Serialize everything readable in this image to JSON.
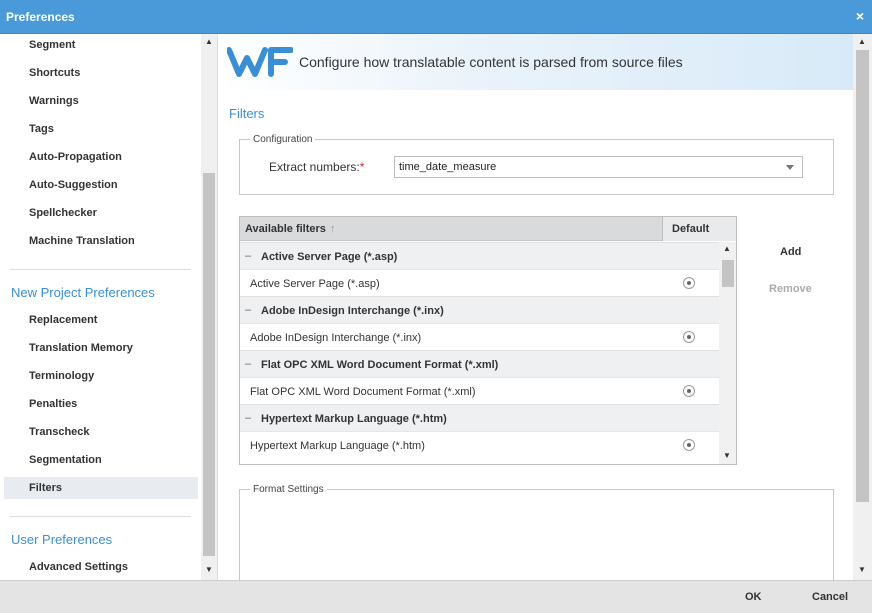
{
  "window": {
    "title": "Preferences",
    "close_icon": "×"
  },
  "sidebar": {
    "items_top": [
      {
        "label": "Segment"
      },
      {
        "label": "Shortcuts"
      },
      {
        "label": "Warnings"
      },
      {
        "label": "Tags"
      },
      {
        "label": "Auto-Propagation"
      },
      {
        "label": "Auto-Suggestion"
      },
      {
        "label": "Spellchecker"
      },
      {
        "label": "Machine Translation"
      }
    ],
    "new_project_heading": "New Project Preferences",
    "items_project": [
      {
        "label": "Replacement"
      },
      {
        "label": "Translation Memory"
      },
      {
        "label": "Terminology"
      },
      {
        "label": "Penalties"
      },
      {
        "label": "Transcheck"
      },
      {
        "label": "Segmentation"
      },
      {
        "label": "Filters",
        "active": true
      }
    ],
    "user_heading": "User Preferences",
    "items_user": [
      {
        "label": "Advanced Settings"
      }
    ]
  },
  "banner": {
    "text": "Configure how translatable content is parsed from source files"
  },
  "section_title": "Filters",
  "configuration": {
    "legend": "Configuration",
    "extract_label": "Extract numbers:",
    "required_mark": "*",
    "extract_value": "time_date_measure"
  },
  "filters_table": {
    "col_available": "Available filters",
    "sort_icon": "↑",
    "col_default": "Default",
    "groups": [
      {
        "group": "Active Server Page (*.asp)",
        "item": "Active Server Page (*.asp)"
      },
      {
        "group": "Adobe InDesign Interchange (*.inx)",
        "item": "Adobe InDesign Interchange (*.inx)"
      },
      {
        "group": "Flat OPC XML Word Document Format (*.xml)",
        "item": "Flat OPC XML Word Document Format (*.xml)"
      },
      {
        "group": "Hypertext Markup Language (*.htm)",
        "item": "Hypertext Markup Language (*.htm)"
      }
    ],
    "collapse_glyph": "–"
  },
  "actions": {
    "add": "Add",
    "remove": "Remove"
  },
  "format_settings": {
    "legend": "Format Settings"
  },
  "footer": {
    "ok": "OK",
    "cancel": "Cancel"
  },
  "colors": {
    "titlebar": "#4a9ad9",
    "accent": "#3a8fd4",
    "required": "#d9232d"
  }
}
